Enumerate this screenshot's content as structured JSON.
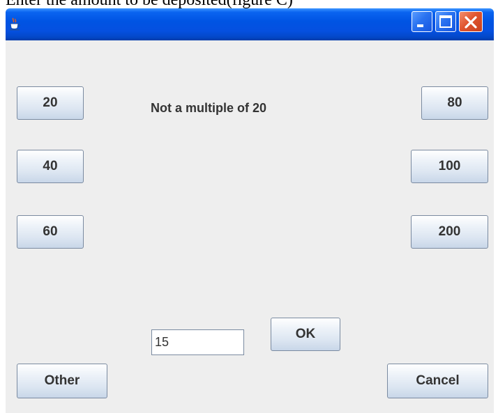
{
  "caption": "Enter the amount to be deposited(figure C)",
  "window": {
    "title": ""
  },
  "message": "Not a multiple of 20",
  "buttons": {
    "b20": "20",
    "b40": "40",
    "b60": "60",
    "b80": "80",
    "b100": "100",
    "b200": "200",
    "ok": "OK",
    "other": "Other",
    "cancel": "Cancel"
  },
  "amount_input": {
    "value": "15"
  },
  "icons": {
    "app": "java-cup-icon",
    "minimize": "minimize-icon",
    "maximize": "maximize-icon",
    "close": "close-icon"
  },
  "colors": {
    "titlebar": "#0054e3",
    "client_bg": "#eeeeee",
    "close_button": "#e0552f"
  }
}
